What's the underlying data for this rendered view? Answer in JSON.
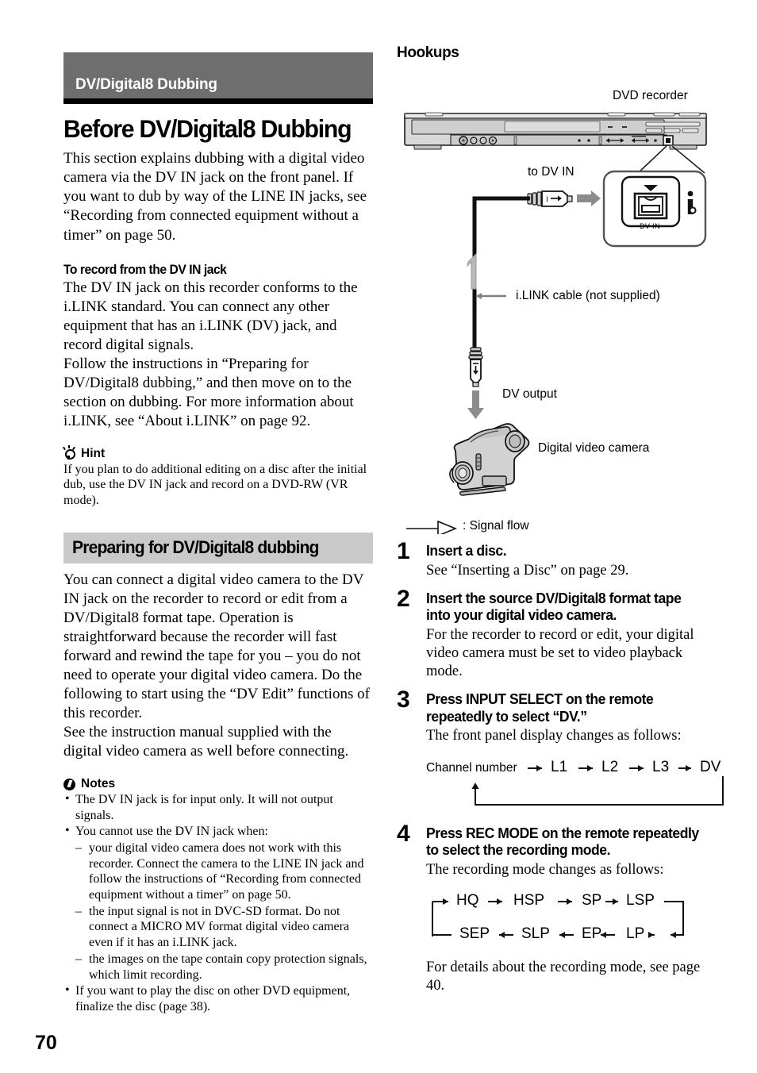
{
  "page": {
    "number": "70"
  },
  "left": {
    "chapter_banner": "DV/Digital8 Dubbing",
    "title": "Before DV/Digital8 Dubbing",
    "intro": "This section explains dubbing with a digital video camera via the DV IN jack on the front panel. If you want to dub by way of the LINE IN jacks, see “Recording from connected equipment without a timer” on page 50.",
    "section1": {
      "heading": "To record from the DV IN jack",
      "para1": "The DV IN jack on this recorder conforms to the i.LINK standard. You can connect any other equipment that has an i.LINK (DV) jack, and record digital signals.",
      "para2": "Follow the instructions in “Preparing for DV/Digital8 dubbing,” and then move on to the section on dubbing. For more information about i.LINK, see “About i.LINK” on page 92."
    },
    "hint": {
      "label": "Hint",
      "icon": "lightbulb-icon",
      "text": "If you plan to do additional editing on a disc after the initial dub, use the DV IN jack and record on a DVD-RW (VR mode)."
    },
    "sub_banner": "Preparing for DV/Digital8 dubbing",
    "section2": {
      "para1": "You can connect a digital video camera to the DV IN jack on the recorder to record or edit from a DV/Digital8 format tape. Operation is straightforward because the recorder will fast forward and rewind the tape for you – you do not need to operate your digital video camera. Do the following to start using the “DV Edit” functions of this recorder.",
      "para2": "See the instruction manual supplied with the digital video camera as well before connecting."
    },
    "notes": {
      "label": "Notes",
      "icon": "exclamation-circle-icon",
      "items": [
        {
          "text": "The DV IN jack is for input only. It will not output signals.",
          "sub": []
        },
        {
          "text": "You cannot use the DV IN jack when:",
          "sub": [
            "your digital video camera does not work with this recorder. Connect the camera to the LINE IN jack and follow the instructions of “Recording from connected equipment without a timer” on page 50.",
            "the input signal is not in DVC-SD format. Do not connect a MICRO MV format digital video camera even if it has an i.LINK jack.",
            "the images on the tape contain copy protection signals, which limit recording."
          ]
        },
        {
          "text": "If you want to play the disc on other DVD equipment, finalize the disc (page 38).",
          "sub": []
        }
      ]
    }
  },
  "right": {
    "heading": "Hookups",
    "diagram": {
      "dvd_recorder_label": "DVD recorder",
      "to_dv_in_label": "to DV IN",
      "dv_in_port_label": "DV IN",
      "ilink_cable_label": "i.LINK cable (not supplied)",
      "dv_output_label": "DV output",
      "camera_label": "Digital video camera",
      "signal_flow_label": ": Signal flow"
    },
    "steps": [
      {
        "num": "1",
        "title": "Insert a disc.",
        "desc": "See “Inserting a Disc” on page 29."
      },
      {
        "num": "2",
        "title": "Insert the source DV/Digital8 format tape into your digital video camera.",
        "desc": "For the recorder to record or edit, your digital video camera must be set to video playback mode."
      },
      {
        "num": "3",
        "title": "Press INPUT SELECT on the remote repeatedly to select “DV.”",
        "desc": "The front panel display changes as follows:"
      },
      {
        "num": "4",
        "title": "Press REC MODE on the remote repeatedly to select the recording mode.",
        "desc": "The recording mode changes as follows:"
      }
    ],
    "input_select_flow": {
      "items": [
        "Channel number",
        "L1",
        "L2",
        "L3",
        "DV"
      ],
      "loops_back": true
    },
    "rec_mode_flow": {
      "row1": [
        "HQ",
        "HSP",
        "SP",
        "LSP"
      ],
      "row2": [
        "SEP",
        "SLP",
        "EP",
        "LP"
      ],
      "loops_back": true
    },
    "footer_note": "For details about the recording mode, see page 40."
  },
  "colors": {
    "banner_dark": "#6e6e6e",
    "banner_light": "#c9c9c9",
    "device_body": "#d5d5d5",
    "arrow_gray": "#8c8c8c",
    "text": "#000000"
  }
}
